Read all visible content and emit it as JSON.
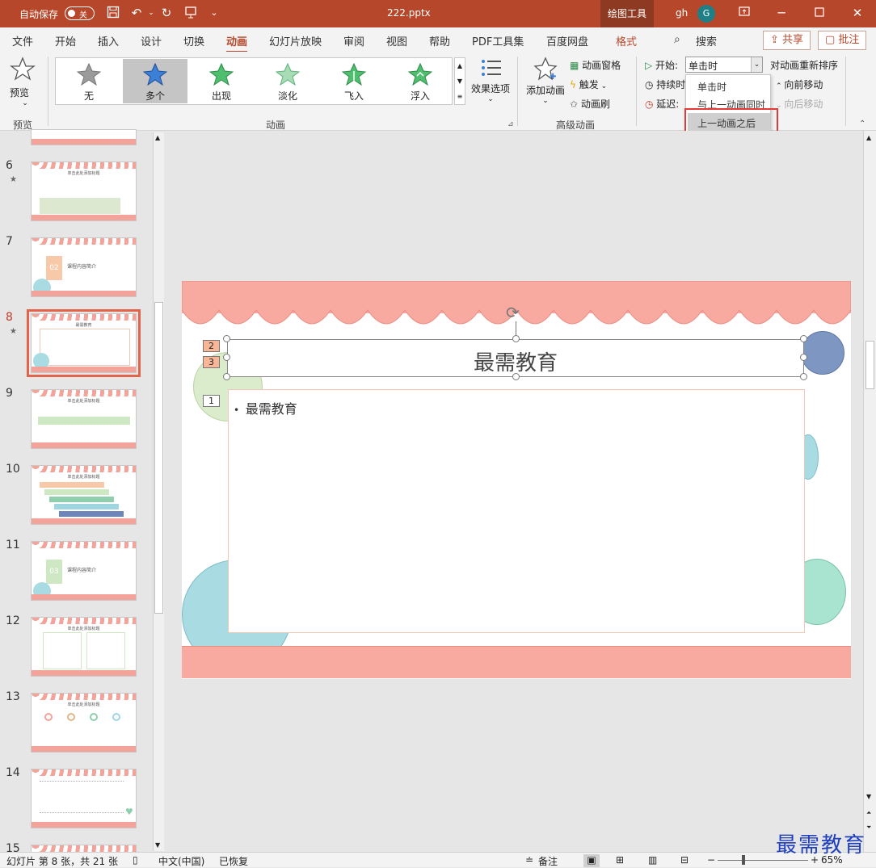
{
  "titlebar": {
    "autosave_label": "自动保存",
    "autosave_state": "关",
    "filename": "222.pptx",
    "context_tab": "绘图工具",
    "user_initials": "gh",
    "avatar_letter": "G"
  },
  "menu": {
    "items": [
      "文件",
      "开始",
      "插入",
      "设计",
      "切换",
      "动画",
      "幻灯片放映",
      "审阅",
      "视图",
      "帮助",
      "PDF工具集",
      "百度网盘",
      "格式"
    ],
    "active": "动画",
    "search": "搜索",
    "share": "共享",
    "comment": "批注"
  },
  "ribbon": {
    "preview": "预览",
    "preview_group": "预览",
    "animations": [
      "无",
      "多个",
      "出现",
      "淡化",
      "飞入",
      "浮入"
    ],
    "selected_animation": "多个",
    "effect_options": "效果选项",
    "animation_group": "动画",
    "add_animation": "添加动画",
    "animation_pane": "动画窗格",
    "trigger": "触发",
    "animation_painter": "动画刷",
    "advanced_group": "高级动画",
    "start_label": "开始:",
    "start_value": "单击时",
    "duration_label": "持续时",
    "delay_label": "延迟:",
    "reorder_title": "对动画重新排序",
    "move_earlier": "向前移动",
    "move_later": "向后移动"
  },
  "start_dropdown": {
    "options": [
      "单击时",
      "与上一动画同时",
      "上一动画之后"
    ],
    "highlighted": "上一动画之后"
  },
  "thumbnails": [
    {
      "num": "6",
      "star": true,
      "title": "单击此处添加标题"
    },
    {
      "num": "7",
      "star": false,
      "title": "课程内容简介",
      "badge": "02"
    },
    {
      "num": "8",
      "star": true,
      "title": "最需教育",
      "active": true
    },
    {
      "num": "9",
      "star": false,
      "title": "单击此处添加标题"
    },
    {
      "num": "10",
      "star": false,
      "title": "单击此处添加标题"
    },
    {
      "num": "11",
      "star": false,
      "title": "课程内容简介",
      "badge": "03"
    },
    {
      "num": "12",
      "star": false,
      "title": "单击此处添加标题"
    },
    {
      "num": "13",
      "star": false,
      "title": "单击此处添加标题"
    },
    {
      "num": "14",
      "star": false,
      "title": ""
    },
    {
      "num": "15",
      "star": false,
      "title": ""
    }
  ],
  "slide": {
    "title": "最需教育",
    "bullet": "最需教育",
    "anim_tags": [
      "2",
      "3",
      "1"
    ]
  },
  "status": {
    "slide_info": "幻灯片 第 8 张，共 21 张",
    "language": "中文(中国)",
    "recovered": "已恢复",
    "notes": "备注",
    "zoom": "65%"
  },
  "watermark": "最需教育",
  "colors": {
    "accent": "#b7472a",
    "salmon": "#f3a39a",
    "highlight_box": "#e53935",
    "arrow": "#e53935"
  }
}
